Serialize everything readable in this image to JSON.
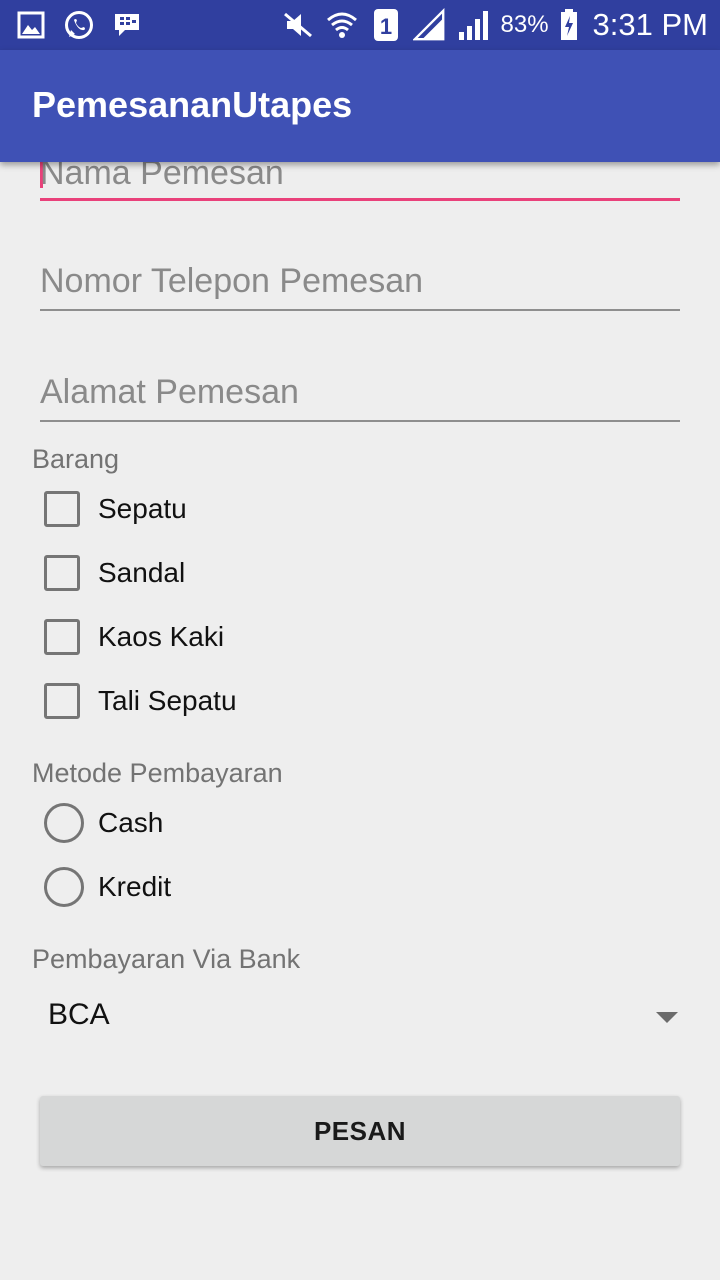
{
  "status_bar": {
    "icons": [
      "gallery-icon",
      "whatsapp-icon",
      "bbm-icon",
      "mute-icon",
      "wifi-icon",
      "sim-1-icon",
      "signal-1-icon",
      "signal-2-icon",
      "battery-icon"
    ],
    "battery": "83%",
    "time": "3:31 PM"
  },
  "app_bar": {
    "title": "PemesananUtapes"
  },
  "form": {
    "name_placeholder": "Nama Pemesan",
    "phone_placeholder": "Nomor Telepon Pemesan",
    "address_placeholder": "Alamat Pemesan",
    "goods_label": "Barang",
    "goods": [
      {
        "label": "Sepatu",
        "checked": false
      },
      {
        "label": "Sandal",
        "checked": false
      },
      {
        "label": "Kaos Kaki",
        "checked": false
      },
      {
        "label": "Tali Sepatu",
        "checked": false
      }
    ],
    "payment_label": "Metode Pembayaran",
    "payment_options": [
      {
        "label": "Cash",
        "selected": false
      },
      {
        "label": "Kredit",
        "selected": false
      }
    ],
    "bank_label": "Pembayaran Via Bank",
    "bank_selected": "BCA",
    "submit_label": "PESAN"
  },
  "colors": {
    "status_bar": "#303f9f",
    "app_bar": "#3f51b5",
    "accent": "#e9417a",
    "background": "#eeeeee",
    "button": "#d6d7d7"
  }
}
